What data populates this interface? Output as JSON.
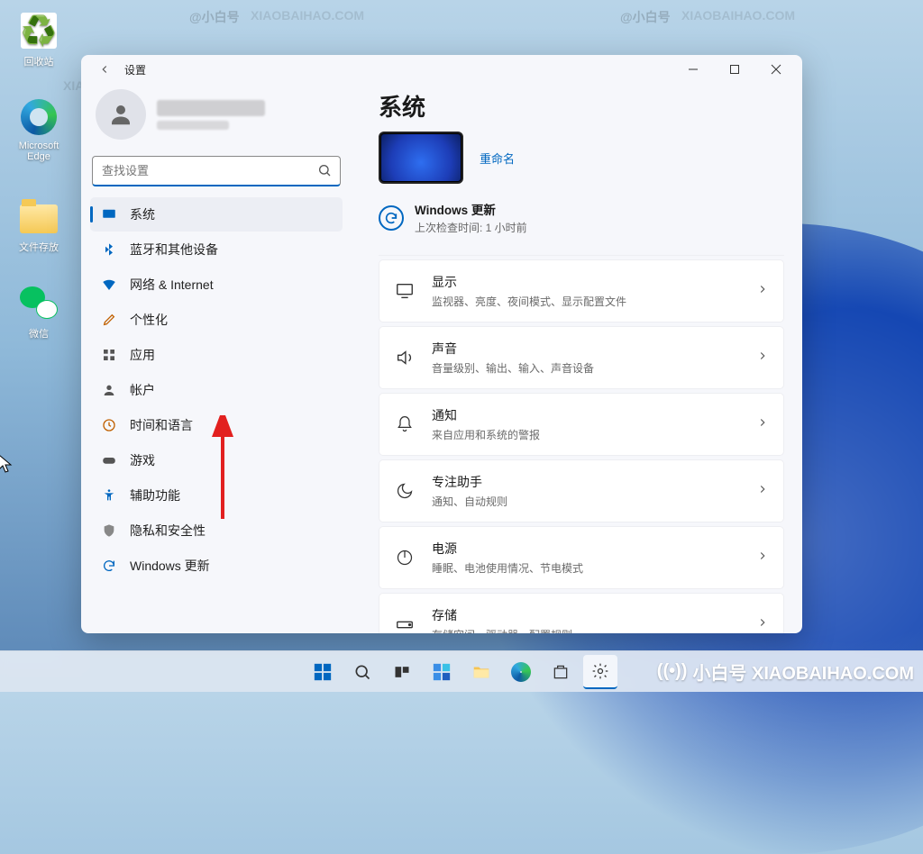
{
  "desktop": {
    "icons": [
      {
        "label": "回收站"
      },
      {
        "label": "Microsoft Edge"
      },
      {
        "label": "文件存放"
      },
      {
        "label": "微信"
      }
    ]
  },
  "watermark": {
    "a": "@小白号",
    "b": "XIAOBAIHAO.COM",
    "corner": "小白号 XIAOBAIHAO.COM"
  },
  "window": {
    "title": "设置",
    "search_placeholder": "查找设置",
    "nav": [
      {
        "label": "系统",
        "active": true
      },
      {
        "label": "蓝牙和其他设备"
      },
      {
        "label": "网络 & Internet"
      },
      {
        "label": "个性化"
      },
      {
        "label": "应用"
      },
      {
        "label": "帐户"
      },
      {
        "label": "时间和语言"
      },
      {
        "label": "游戏"
      },
      {
        "label": "辅助功能"
      },
      {
        "label": "隐私和安全性"
      },
      {
        "label": "Windows 更新"
      }
    ],
    "main_title": "系统",
    "rename": "重命名",
    "update_title": "Windows 更新",
    "update_desc": "上次检查时间: 1 小时前",
    "cards": [
      {
        "title": "显示",
        "desc": "监视器、亮度、夜间模式、显示配置文件"
      },
      {
        "title": "声音",
        "desc": "音量级别、输出、输入、声音设备"
      },
      {
        "title": "通知",
        "desc": "来自应用和系统的警报"
      },
      {
        "title": "专注助手",
        "desc": "通知、自动规则"
      },
      {
        "title": "电源",
        "desc": "睡眠、电池使用情况、节电模式"
      },
      {
        "title": "存储",
        "desc": "存储空间、驱动器、配置规则"
      }
    ]
  }
}
